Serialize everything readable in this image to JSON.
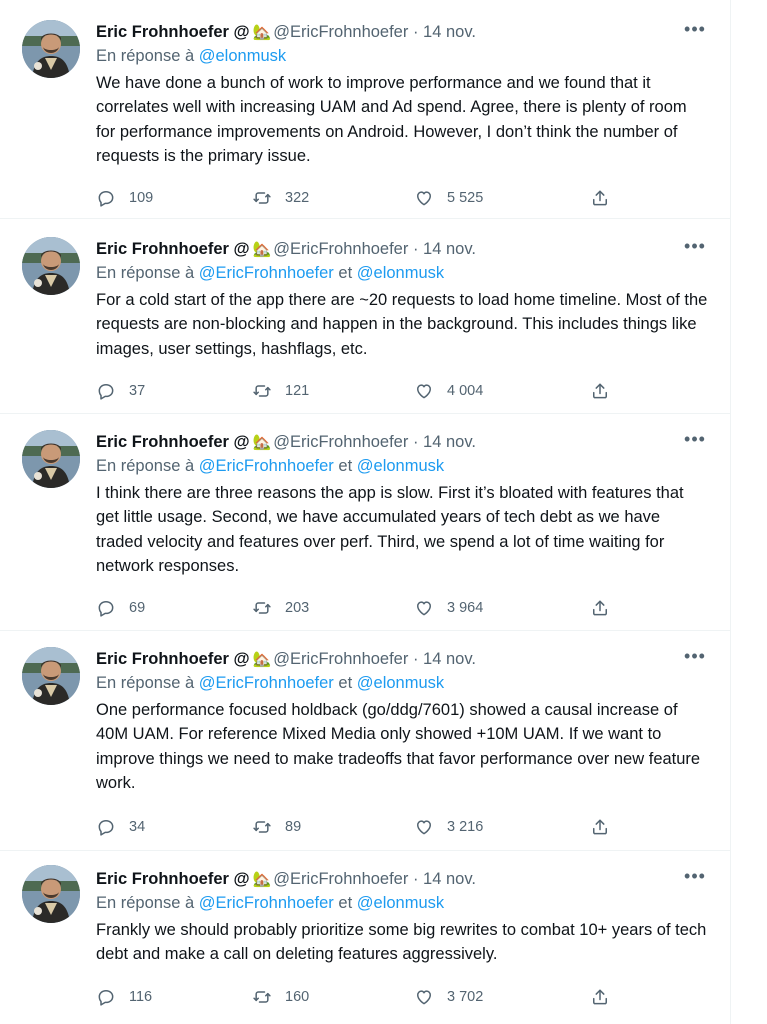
{
  "tweets": [
    {
      "name": "Eric Frohnhoefer @",
      "emoji": "🏡",
      "handle": "@EricFrohnhoefer",
      "date": "14 nov.",
      "reply_prefix": "En réponse à",
      "reply_to": [
        "@elonmusk"
      ],
      "reply_joiner": "et",
      "text": "We have done a bunch of work to improve performance and we found that it correlates well with increasing UAM and Ad spend. Agree, there is plenty of room for performance improvements on Android. However, I don’t think the number of requests is the primary issue.",
      "replies": "109",
      "retweets": "322",
      "likes": "5 525"
    },
    {
      "name": "Eric Frohnhoefer @",
      "emoji": "🏡",
      "handle": "@EricFrohnhoefer",
      "date": "14 nov.",
      "reply_prefix": "En réponse à",
      "reply_to": [
        "@EricFrohnhoefer",
        "@elonmusk"
      ],
      "reply_joiner": "et",
      "text": "For a cold start of the app there are ~20 requests to load home timeline. Most of the requests are non-blocking and happen in the background. This includes things like images, user settings, hashflags, etc.",
      "replies": "37",
      "retweets": "121",
      "likes": "4 004"
    },
    {
      "name": "Eric Frohnhoefer @",
      "emoji": "🏡",
      "handle": "@EricFrohnhoefer",
      "date": "14 nov.",
      "reply_prefix": "En réponse à",
      "reply_to": [
        "@EricFrohnhoefer",
        "@elonmusk"
      ],
      "reply_joiner": "et",
      "text": "I think there are three reasons the app is slow. First it’s bloated with features that get little usage. Second, we have accumulated years of tech debt as we have traded velocity and features over perf. Third, we spend a lot of time waiting for network responses.",
      "replies": "69",
      "retweets": "203",
      "likes": "3 964"
    },
    {
      "name": "Eric Frohnhoefer @",
      "emoji": "🏡",
      "handle": "@EricFrohnhoefer",
      "date": "14 nov.",
      "reply_prefix": "En réponse à",
      "reply_to": [
        "@EricFrohnhoefer",
        "@elonmusk"
      ],
      "reply_joiner": "et",
      "text": "One performance focused holdback (go/ddg/7601) showed a causal increase of 40M UAM. For reference Mixed Media only showed +10M UAM. If we want to improve things we need to make tradeoffs that favor performance over new feature work.",
      "replies": "34",
      "retweets": "89",
      "likes": "3 216"
    },
    {
      "name": "Eric Frohnhoefer @",
      "emoji": "🏡",
      "handle": "@EricFrohnhoefer",
      "date": "14 nov.",
      "reply_prefix": "En réponse à",
      "reply_to": [
        "@EricFrohnhoefer",
        "@elonmusk"
      ],
      "reply_joiner": "et",
      "text": "Frankly we should probably prioritize some big rewrites to combat 10+ years of tech debt and make a call on deleting features aggressively.",
      "replies": "116",
      "retweets": "160",
      "likes": "3 702"
    }
  ],
  "ui": {
    "separator": "·",
    "more_icon": "more-horizontal-icon",
    "reply_icon": "reply-bubble-icon",
    "retweet_icon": "retweet-icon",
    "like_icon": "heart-icon",
    "share_icon": "share-upload-icon",
    "mention_color": "#1d9bf0",
    "muted_color": "#536471"
  }
}
